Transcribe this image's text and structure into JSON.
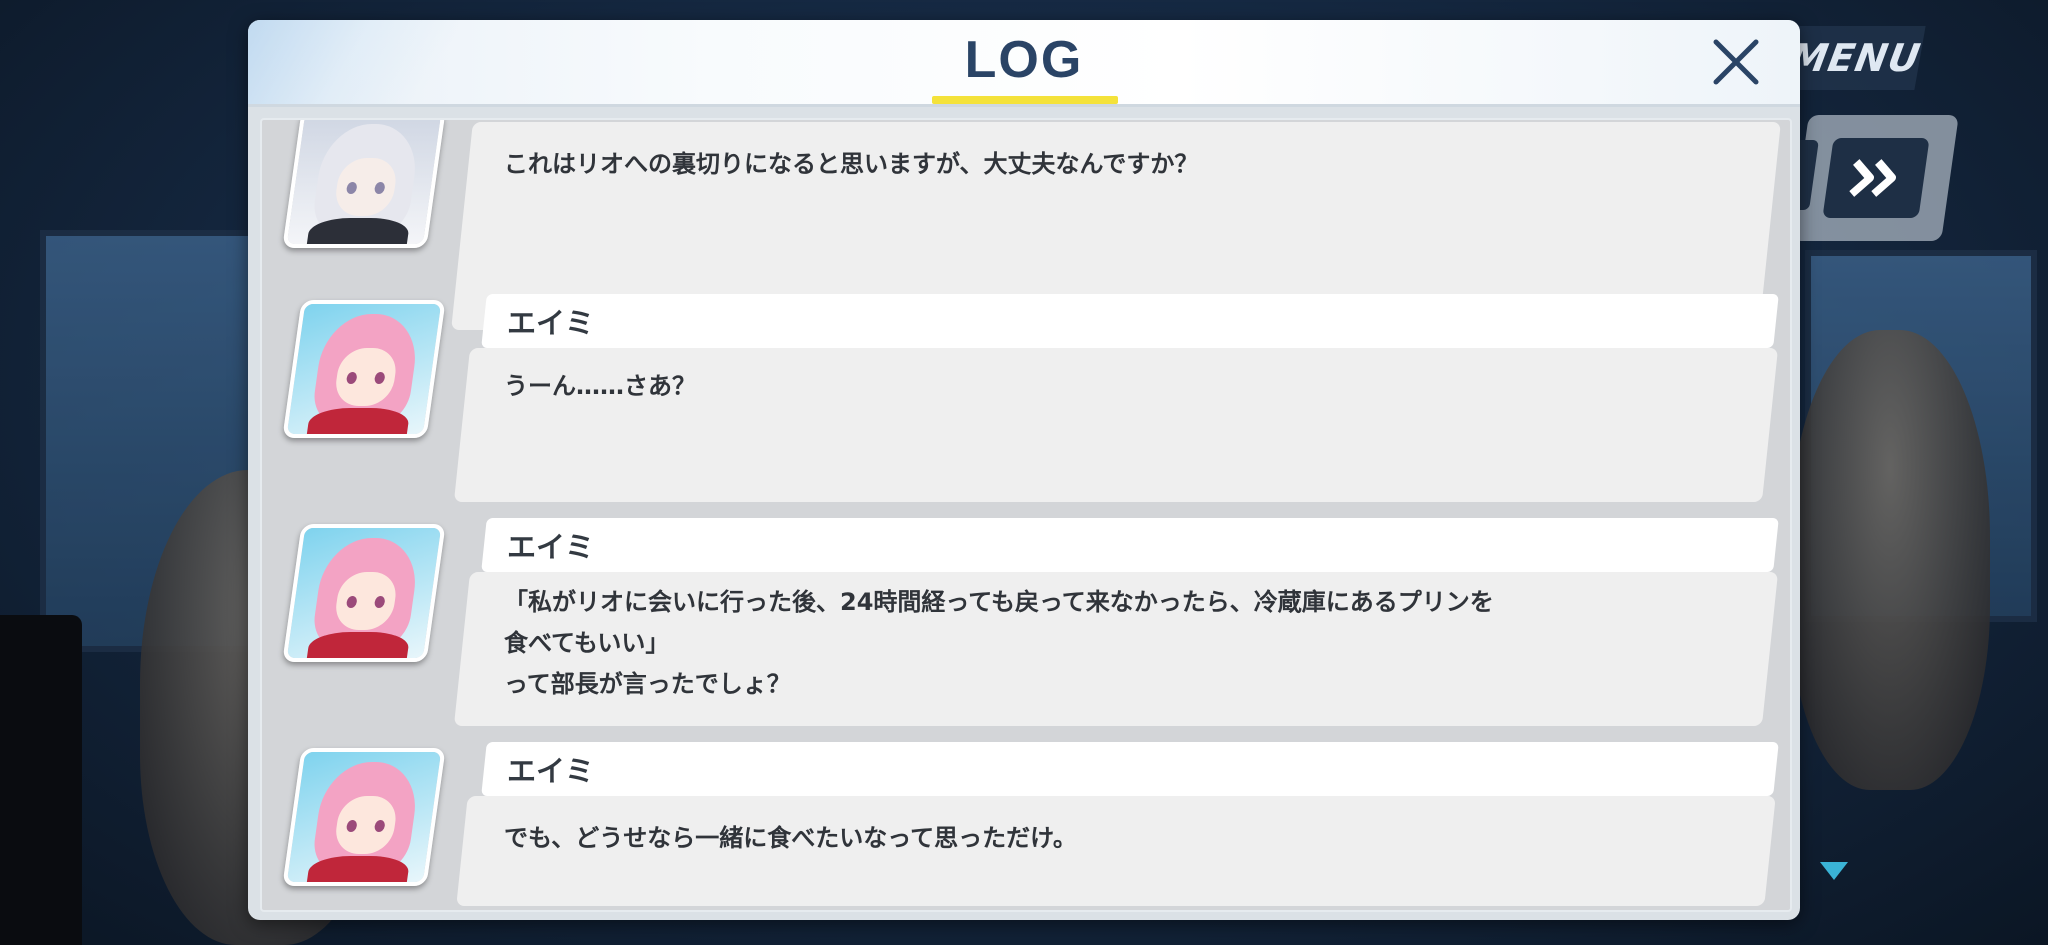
{
  "log": {
    "title": "LOG",
    "close_label": "✕",
    "entries": [
      {
        "speaker": "",
        "portrait": "white-haired-student",
        "text": "これはリオへの裏切りになると思いますが、大丈夫なんですか？"
      },
      {
        "speaker": "エイミ",
        "portrait": "eimi",
        "text": "うーん……さあ？"
      },
      {
        "speaker": "エイミ",
        "portrait": "eimi",
        "text": "「私がリオに会いに行った後、24時間経っても戻って来なかったら、冷蔵庫にあるプリンを\n食べてもいい」\nって部長が言ったでしょ？"
      },
      {
        "speaker": "エイミ",
        "portrait": "eimi",
        "text": "でも、どうせなら一緒に食べたいなって思っただけ。"
      }
    ]
  },
  "menu": {
    "label": "MENU"
  },
  "skip": {
    "icon": "fast-forward-icon"
  },
  "colors": {
    "title": "#2a4466",
    "underline": "#f4e23a",
    "eimi_hair": "#f3a3c4",
    "white_hair": "#e6e7ee"
  }
}
